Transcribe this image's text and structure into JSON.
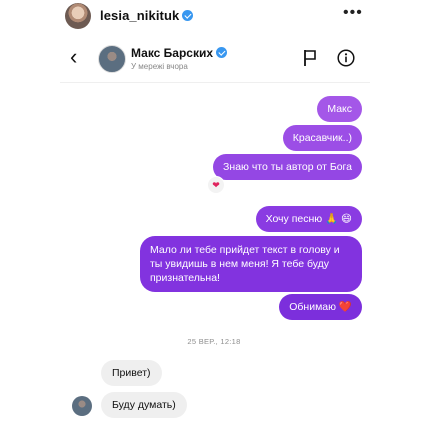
{
  "post": {
    "username": "lesia_nikituk",
    "more_label": "•••"
  },
  "chat": {
    "back_label": "‹",
    "name": "Макс Барских",
    "status": "У мережі вчора"
  },
  "messages_out": [
    "Макс",
    "Красавчик..)",
    "Знаю что ты автор от Бога",
    "Хочу песню 🙏 😄",
    "Мало ли тебе прийдет текст в голову и ты увидишь в нем меня! Я тебе буду признательна!",
    "Обнимаю ❤️"
  ],
  "reaction": "❤",
  "date_separator": "25 ВЕР., 12:18",
  "messages_in": [
    "Привет)",
    "Буду думать)"
  ],
  "colors": {
    "bubble_purple": "#8a3ae0",
    "incoming_bubble": "#efefef",
    "verified_blue": "#3897f0"
  },
  "icons": [
    "verified-icon",
    "more-icon",
    "back-icon",
    "flag-icon",
    "info-icon",
    "heart-reaction-icon"
  ]
}
